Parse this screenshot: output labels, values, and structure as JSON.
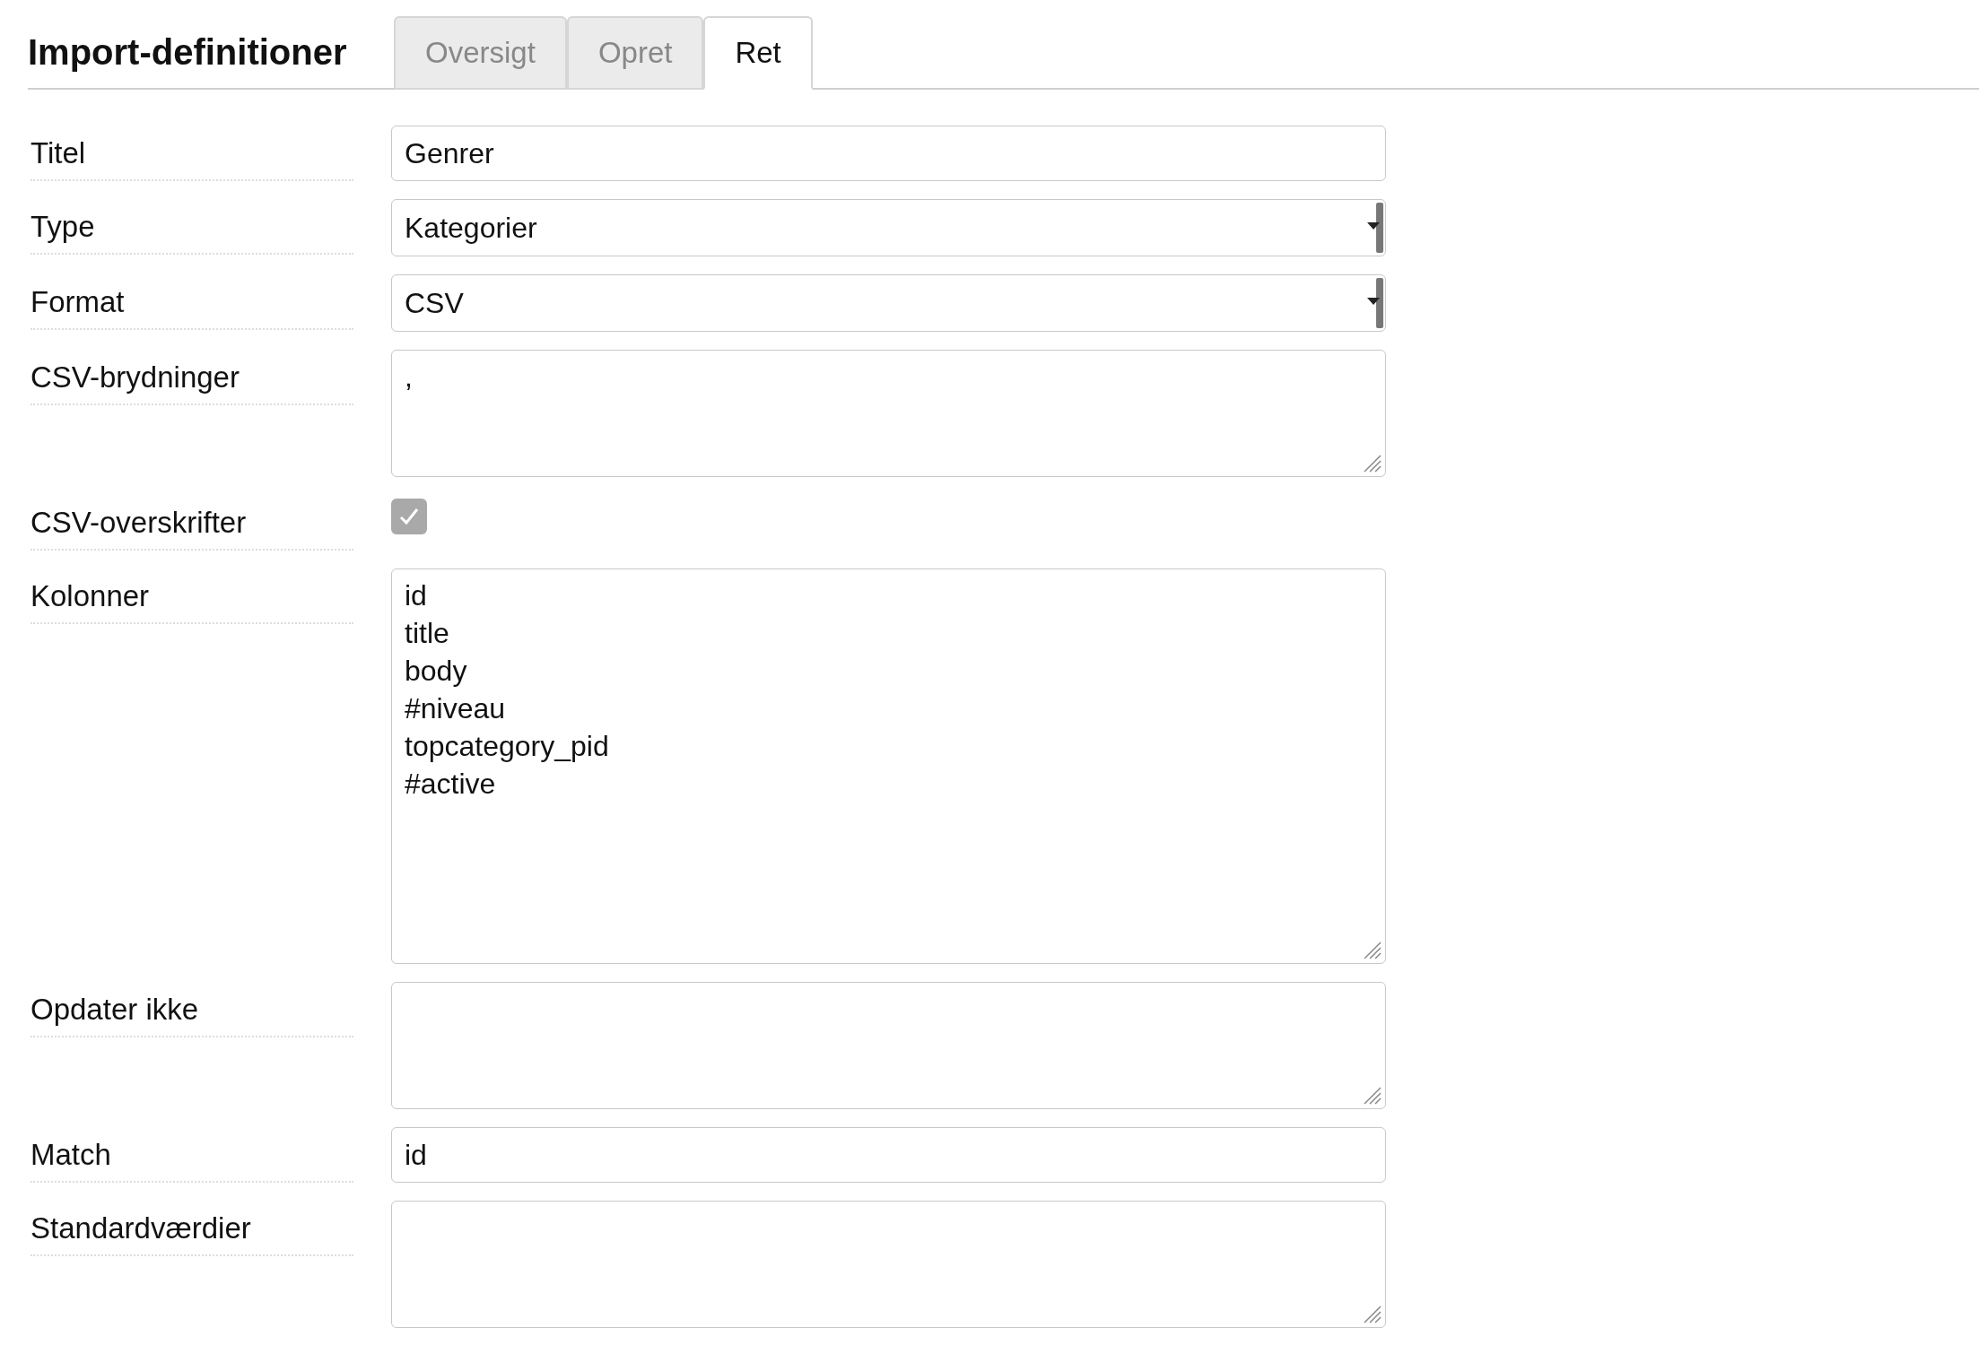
{
  "title": "Import-definitioner",
  "tabs": [
    {
      "label": "Oversigt",
      "selected": false
    },
    {
      "label": "Opret",
      "selected": false
    },
    {
      "label": "Ret",
      "selected": true
    }
  ],
  "fields": [
    {
      "label": "Titel",
      "kind": "text",
      "value": "Genrer"
    },
    {
      "label": "Type",
      "kind": "select",
      "value": "Kategorier"
    },
    {
      "label": "Format",
      "kind": "select",
      "value": "CSV"
    },
    {
      "label": "CSV-brydninger",
      "kind": "textarea",
      "value": ","
    },
    {
      "label": "CSV-overskrifter",
      "kind": "checkbox",
      "checked": true
    },
    {
      "label": "Kolonner",
      "kind": "list",
      "value": "id\ntitle\nbody\n#niveau\ntopcategory_pid\n#active"
    },
    {
      "label": "Opdater ikke",
      "kind": "textarea"
    },
    {
      "label": "Match",
      "kind": "text",
      "value": "id"
    },
    {
      "label": "Standardværdier",
      "kind": "textarea"
    }
  ]
}
